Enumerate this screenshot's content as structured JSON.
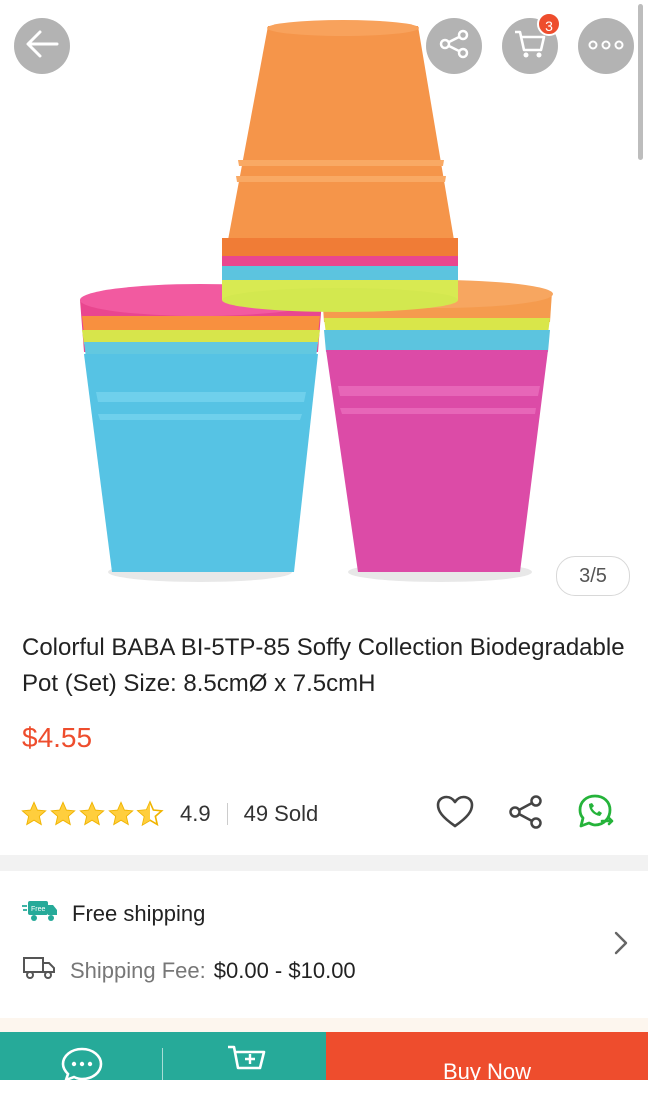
{
  "header": {
    "back_icon": "arrow-left-icon",
    "share_icon": "share-icon",
    "cart_icon": "cart-icon",
    "cart_count": "3",
    "more_icon": "more-dots-icon"
  },
  "gallery": {
    "counter": "3/5"
  },
  "product": {
    "title": "Colorful BABA BI-5TP-85 Soffy Collection Biodegradable Pot (Set) Size: 8.5cmØ x 7.5cmH",
    "price": "$4.55",
    "rating": "4.9",
    "stars": 4.5,
    "sold": "49 Sold",
    "action_icons": [
      "heart-icon",
      "share-icon",
      "whatsapp-icon"
    ]
  },
  "shipping": {
    "free_label": "Free shipping",
    "free_badge": "Free",
    "fee_label": "Shipping Fee:",
    "fee_value": "$0.00 - $10.00"
  },
  "bottom_bar": {
    "chat_icon": "chat-icon",
    "add_to_cart_icon": "add-to-cart-icon",
    "buy_now_label": "Buy Now"
  },
  "colors": {
    "accent": "#ee4d2d",
    "green": "#26aa99",
    "star": "#ffce3d"
  }
}
